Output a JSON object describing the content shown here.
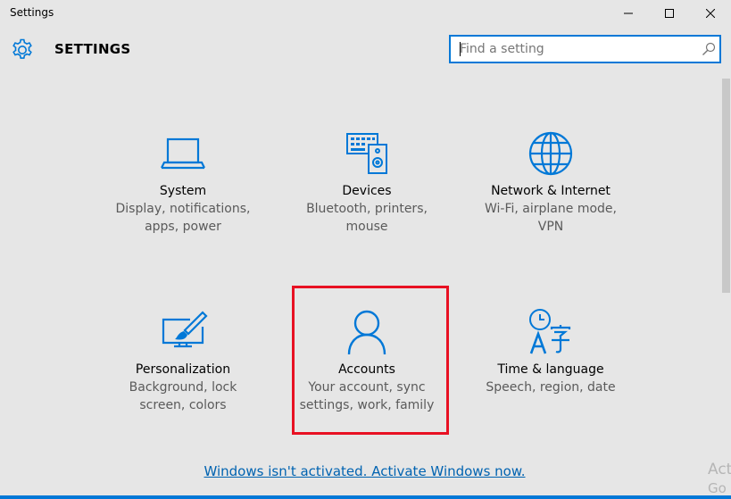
{
  "window": {
    "title": "Settings"
  },
  "header": {
    "heading": "SETTINGS",
    "search": {
      "placeholder": "Find a setting",
      "value": ""
    }
  },
  "tiles": [
    {
      "name": "System",
      "description": "Display, notifications,\napps, power",
      "icon": "laptop-icon"
    },
    {
      "name": "Devices",
      "description": "Bluetooth, printers,\nmouse",
      "icon": "devices-icon"
    },
    {
      "name": "Network & Internet",
      "description": "Wi-Fi, airplane mode,\nVPN",
      "icon": "globe-icon"
    },
    {
      "name": "Personalization",
      "description": "Background, lock\nscreen, colors",
      "icon": "paintbrush-icon"
    },
    {
      "name": "Accounts",
      "description": "Your account, sync\nsettings, work, family",
      "icon": "person-icon"
    },
    {
      "name": "Time & language",
      "description": "Speech, region, date",
      "icon": "time-language-icon"
    }
  ],
  "footer": {
    "activate_link": "Windows isn't activated. Activate Windows now.",
    "watermark_line1": "Act",
    "watermark_line2": "Go"
  },
  "colors": {
    "accent": "#0078d7",
    "highlight": "#e81123",
    "background": "#e6e6e6"
  }
}
